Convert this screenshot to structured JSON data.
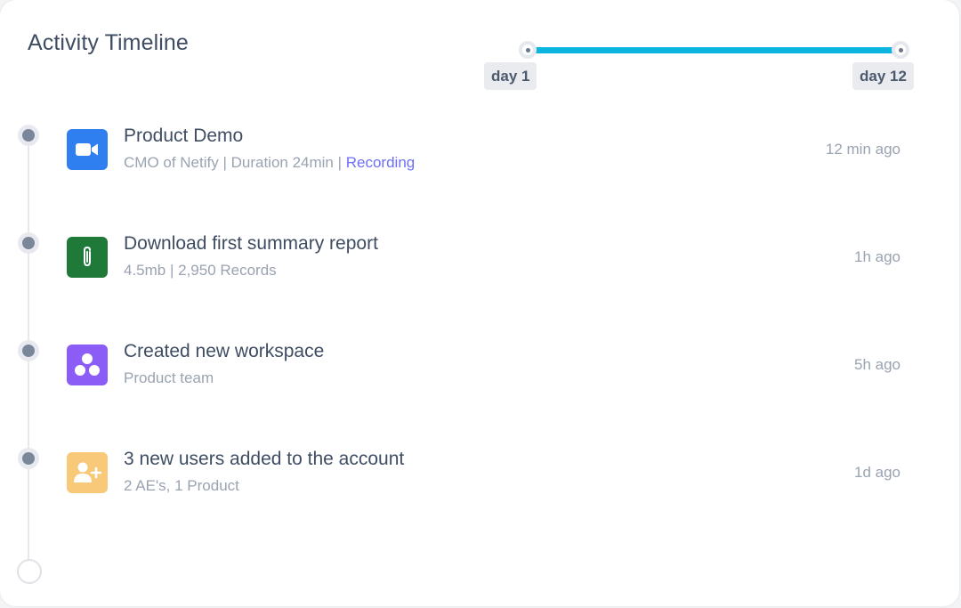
{
  "title": "Activity Timeline",
  "range": {
    "min_label": "day 1",
    "max_label": "day 12",
    "track_color": "#0bb5e0"
  },
  "items": [
    {
      "title": "Product Demo",
      "subtitle": "CMO of Netify | Duration 24min | ",
      "link": "Recording",
      "time": "12 min ago",
      "icon": "video-camera-icon",
      "icon_color": "#2f7ff0"
    },
    {
      "title": "Download first summary report",
      "subtitle": "4.5mb | 2,950 Records",
      "time": "1h ago",
      "icon": "paperclip-icon",
      "icon_color": "#1f7a3a"
    },
    {
      "title": "Created new workspace",
      "subtitle": "Product team",
      "time": "5h ago",
      "icon": "workspace-icon",
      "icon_color": "#8b5cf6"
    },
    {
      "title": "3 new users added to the account",
      "subtitle": "2 AE's, 1 Product",
      "time": "1d ago",
      "icon": "add-user-icon",
      "icon_color": "#f7c978"
    }
  ]
}
